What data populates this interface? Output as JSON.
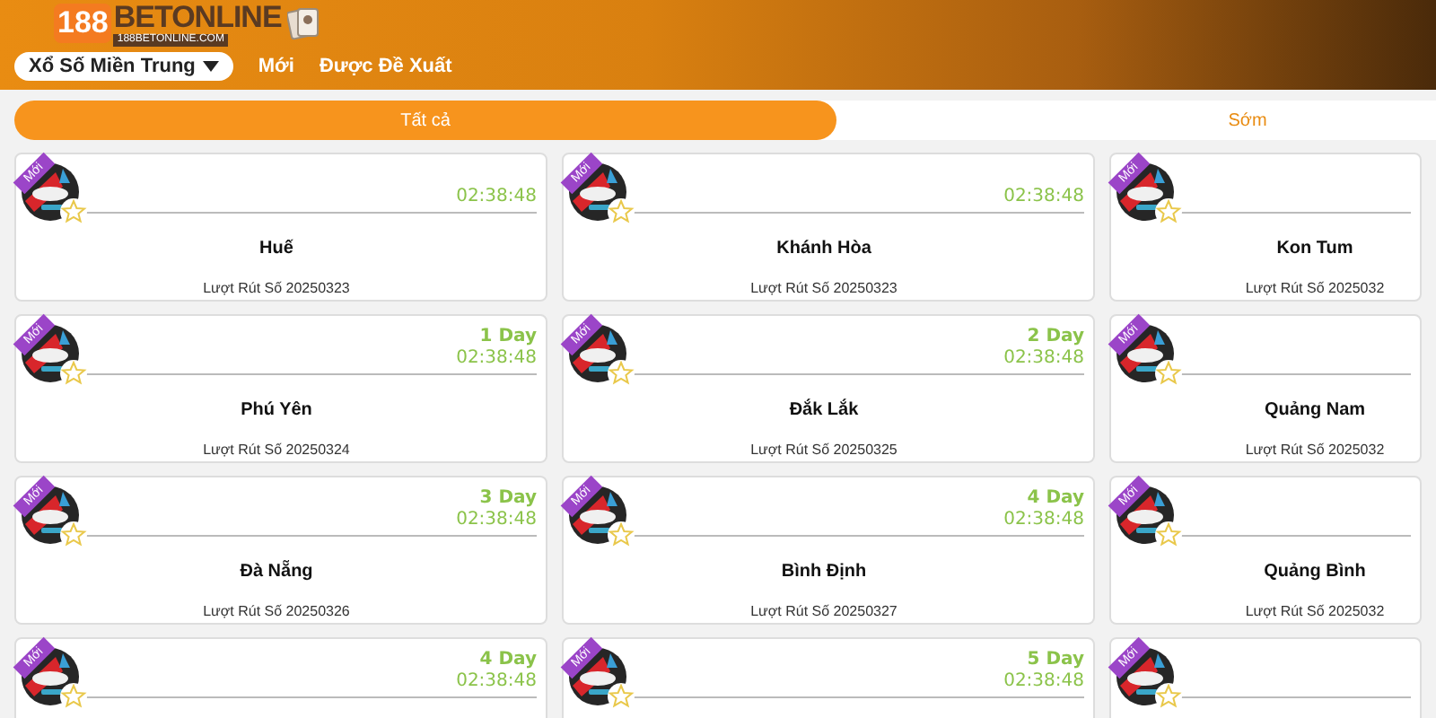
{
  "logo": {
    "brand_number": "188",
    "brand_name": "BETONLINE",
    "domain": "188BETONLINE.COM"
  },
  "nav": {
    "dropdown": "Xổ Số Miền Trung",
    "links": [
      "Mới",
      "Được Đề Xuất"
    ]
  },
  "tabs": [
    {
      "label": "Tất cả",
      "selected": true
    },
    {
      "label": "Sớm",
      "selected": false
    }
  ],
  "cards": [
    {
      "badge": "Mới",
      "time": "02:38:48",
      "name": "Huế",
      "draw": "Lượt Rút Số 20250323"
    },
    {
      "badge": "Mới",
      "time": "02:38:48",
      "name": "Khánh Hòa",
      "draw": "Lượt Rút Số 20250323"
    },
    {
      "badge": "Mới",
      "name": "Kon Tum",
      "draw": "Lượt Rút Số 2025032"
    },
    {
      "badge": "Mới",
      "day": "1 Day",
      "time": "02:38:48",
      "name": "Phú Yên",
      "draw": "Lượt Rút Số 20250324"
    },
    {
      "badge": "Mới",
      "day": "2 Day",
      "time": "02:38:48",
      "name": "Đắk Lắk",
      "draw": "Lượt Rút Số 20250325"
    },
    {
      "badge": "Mới",
      "name": "Quảng Nam",
      "draw": "Lượt Rút Số 2025032"
    },
    {
      "badge": "Mới",
      "day": "3 Day",
      "time": "02:38:48",
      "name": "Đà Nẵng",
      "draw": "Lượt Rút Số 20250326"
    },
    {
      "badge": "Mới",
      "day": "4 Day",
      "time": "02:38:48",
      "name": "Bình Định",
      "draw": "Lượt Rút Số 20250327"
    },
    {
      "badge": "Mới",
      "name": "Quảng Bình",
      "draw": "Lượt Rút Số 2025032"
    },
    {
      "badge": "Mới",
      "day": "4 Day",
      "time": "02:38:48"
    },
    {
      "badge": "Mới",
      "day": "5 Day",
      "time": "02:38:48"
    },
    {
      "badge": "Mới"
    }
  ]
}
